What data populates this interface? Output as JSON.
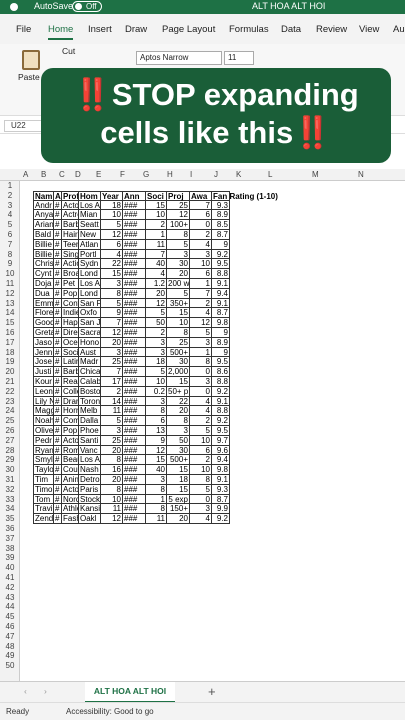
{
  "titlebar": {
    "autosave": "AutoSave",
    "toggle": "Off",
    "doc": "ALT HOA ALT HOI"
  },
  "tabs": [
    "File",
    "Home",
    "Insert",
    "Draw",
    "Page Layout",
    "Formulas",
    "Data",
    "Review",
    "View",
    "Au"
  ],
  "ribbon": {
    "cut": "Cut",
    "paste": "Paste",
    "font": "Aptos Narrow",
    "size": "11"
  },
  "overlay": {
    "line1": "‼️STOP expanding",
    "line2": "cells like this‼️"
  },
  "namebox": "U22",
  "columns": [
    "A",
    "B",
    "C",
    "D",
    "E",
    "F",
    "G",
    "H",
    "I",
    "J",
    "K",
    "L",
    "M",
    "N"
  ],
  "header_row": [
    "Nam",
    "Ag",
    "Prof",
    "Hom",
    "Year",
    "Ann",
    "Soci",
    "Proj",
    "Awa",
    "Fan Rating (1-10)"
  ],
  "rows": [
    [
      "Andr",
      "#",
      "Acto",
      "Los A",
      "18",
      "###",
      "15",
      "25",
      "7",
      "9.3"
    ],
    [
      "Anya",
      "#",
      "Actre",
      "Mian",
      "10",
      "###",
      "10",
      "12",
      "6",
      "8.9"
    ],
    [
      "Arian",
      "#",
      "Barb",
      "Seatt",
      "5",
      "###",
      "2",
      "100+",
      "0",
      "8.5"
    ],
    [
      "Bald",
      "#",
      "Hair",
      "New",
      "12",
      "###",
      "1",
      "8",
      "2",
      "8.7"
    ],
    [
      "Billie",
      "#",
      "Teen",
      "Atlan",
      "6",
      "###",
      "11",
      "5",
      "4",
      "9"
    ],
    [
      "Billie",
      "#",
      "Sing",
      "Portl",
      "4",
      "###",
      "7",
      "3",
      "3",
      "9.2"
    ],
    [
      "Chris",
      "#",
      "Actio",
      "Sydn",
      "22",
      "###",
      "40",
      "30",
      "10",
      "9.5"
    ],
    [
      "Cynt",
      "#",
      "Broa",
      "Lond",
      "15",
      "###",
      "4",
      "20",
      "6",
      "8.8"
    ],
    [
      "Doja",
      "#",
      "Pet In",
      "Los A",
      "3",
      "###",
      "1.2",
      "200 w",
      "1",
      "9.1"
    ],
    [
      "Dua",
      "#",
      "Pop",
      "Lond",
      "8",
      "###",
      "20",
      "5",
      "7",
      "9.4"
    ],
    [
      "Emm",
      "#",
      "Cont",
      "San F",
      "5",
      "###",
      "12",
      "350+",
      "2",
      "9.1"
    ],
    [
      "Flore",
      "#",
      "Indie",
      "Oxfo",
      "9",
      "###",
      "5",
      "15",
      "4",
      "8.7"
    ],
    [
      "Good",
      "#",
      "Happ",
      "San J",
      "7",
      "###",
      "50",
      "10",
      "12",
      "9.8"
    ],
    [
      "Greta",
      "#",
      "Direc",
      "Sacra",
      "12",
      "###",
      "2",
      "8",
      "5",
      "9"
    ],
    [
      "Jaso",
      "#",
      "Ocea",
      "Hono",
      "20",
      "###",
      "3",
      "25",
      "3",
      "8.9"
    ],
    [
      "Jenn",
      "#",
      "Socia",
      "Aust",
      "3",
      "###",
      "3",
      "500+",
      "1",
      "9"
    ],
    [
      "Jose",
      "#",
      "Latin",
      "Madr",
      "25",
      "###",
      "18",
      "30",
      "8",
      "9.5"
    ],
    [
      "Justi",
      "#",
      "Barb",
      "Chica",
      "7",
      "###",
      "5",
      "2,000",
      "0",
      "8.6"
    ],
    [
      "Kour",
      "#",
      "Real",
      "Calab",
      "17",
      "###",
      "10",
      "15",
      "3",
      "8.8"
    ],
    [
      "Leon",
      "#",
      "Colle",
      "Bosto",
      "2",
      "###",
      "0.2",
      "50+ p",
      "0",
      "9.2"
    ],
    [
      "Lily N",
      "#",
      "Dran",
      "Toron",
      "14",
      "###",
      "3",
      "22",
      "4",
      "9.1"
    ],
    [
      "Magg",
      "#",
      "Horr",
      "Melb",
      "11",
      "###",
      "8",
      "20",
      "4",
      "8.8"
    ],
    [
      "Noah",
      "#",
      "Com",
      "Dalla",
      "5",
      "###",
      "6",
      "8",
      "2",
      "9.2"
    ],
    [
      "Olive",
      "#",
      "Pop",
      "Phoe",
      "3",
      "###",
      "13",
      "3",
      "5",
      "9.5"
    ],
    [
      "Pedr",
      "#",
      "Acto",
      "Santi",
      "25",
      "###",
      "9",
      "50",
      "10",
      "9.7"
    ],
    [
      "Ryan",
      "#",
      "Rom",
      "Vanc",
      "20",
      "###",
      "12",
      "30",
      "6",
      "9.6"
    ],
    [
      "Smyl",
      "#",
      "Beau",
      "Los A",
      "8",
      "###",
      "15",
      "500+",
      "2",
      "9.4"
    ],
    [
      "Taylo",
      "#",
      "Coun",
      "Nash",
      "16",
      "###",
      "40",
      "15",
      "10",
      "9.8"
    ],
    [
      "Tim",
      "#",
      "Anim",
      "Detro",
      "20",
      "###",
      "3",
      "18",
      "8",
      "9.1"
    ],
    [
      "Timo",
      "#",
      "Acto",
      "Paris",
      "8",
      "###",
      "8",
      "15",
      "5",
      "9.3"
    ],
    [
      "Tom",
      "#",
      "Nord",
      "Stock",
      "10",
      "###",
      "1",
      "5 exp",
      "0",
      "8.7"
    ],
    [
      "Travi",
      "#",
      "Athle",
      "Kansi",
      "11",
      "###",
      "8",
      "150+",
      "3",
      "9.9"
    ],
    [
      "Zend",
      "#",
      "Fash",
      "Oakl",
      "12",
      "###",
      "11",
      "20",
      "4",
      "9.2"
    ]
  ],
  "row_numbers": [
    "1",
    "2",
    "3",
    "4",
    "5",
    "6",
    "7",
    "8",
    "9",
    "10",
    "11",
    "12",
    "13",
    "14",
    "15",
    "16",
    "17",
    "18",
    "19",
    "20",
    "21",
    "22",
    "23",
    "24",
    "25",
    "26",
    "27",
    "28",
    "29",
    "30",
    "31",
    "32",
    "33",
    "34",
    "35",
    "36",
    "37",
    "38",
    "39",
    "40",
    "41",
    "42",
    "43",
    "44",
    "45",
    "46",
    "47",
    "48",
    "49",
    "50"
  ],
  "sheet_tab": "ALT HOA ALT HOI",
  "status": {
    "ready": "Ready",
    "accessibility": "Accessibility: Good to go"
  }
}
